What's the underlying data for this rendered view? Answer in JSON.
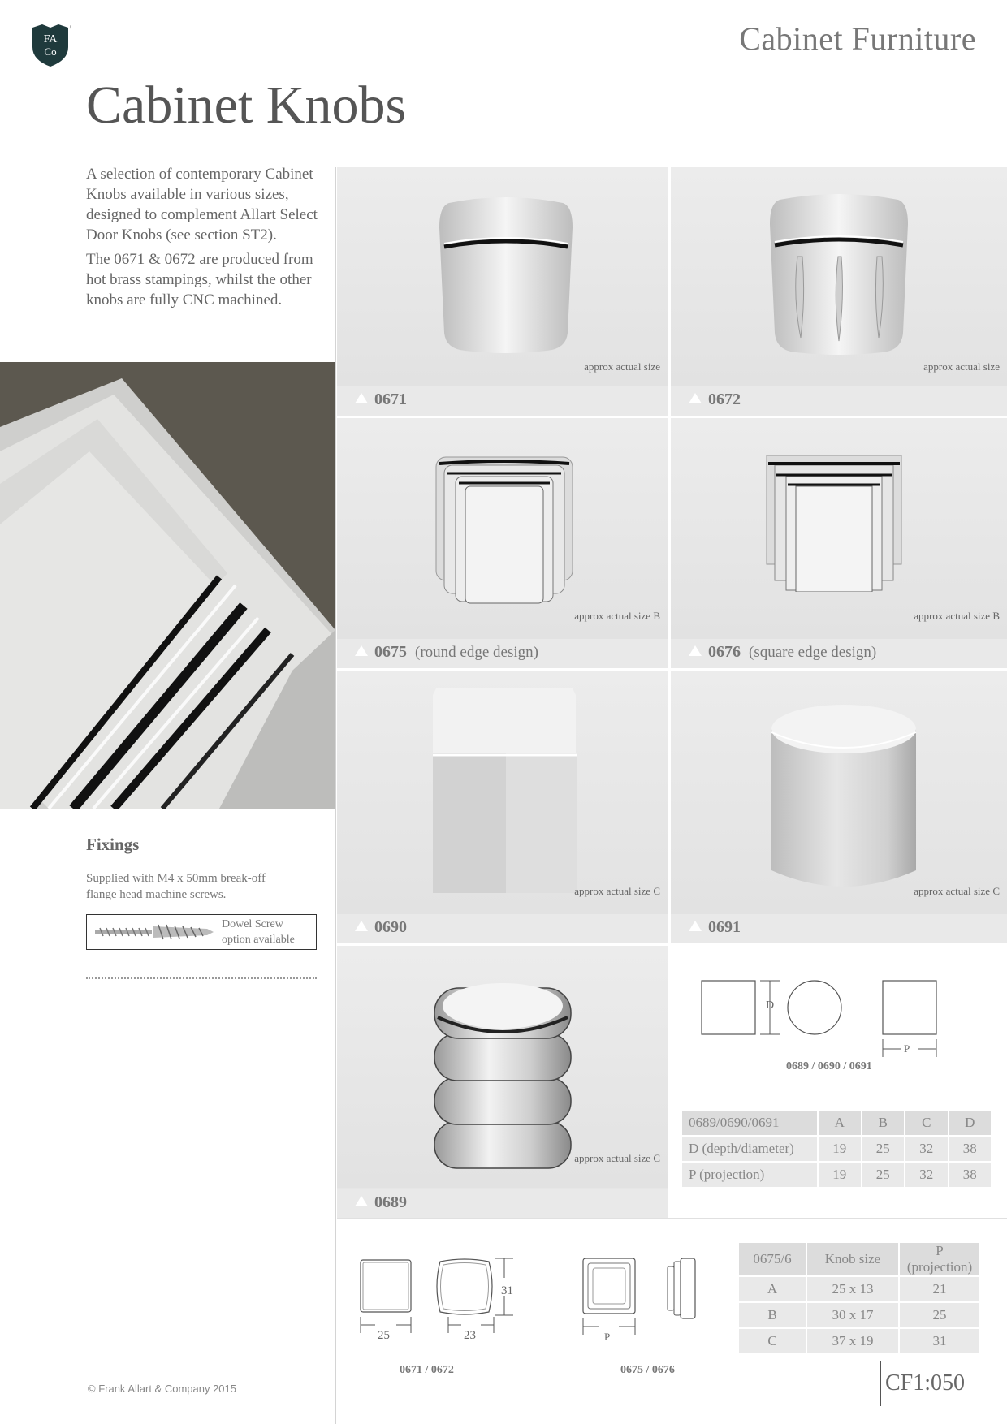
{
  "header": {
    "logo_text": "FA Co",
    "section_title": "Cabinet Furniture",
    "page_title": "Cabinet Knobs"
  },
  "intro": {
    "paragraph1": "A selection of contemporary Cabinet Knobs available in various sizes, designed to complement Allart Select Door Knobs (see section ST2).",
    "paragraph2": "The 0671 & 0672 are produced from hot brass stampings, whilst the other knobs are fully CNC machined."
  },
  "fixings": {
    "title": "Fixings",
    "text": "Supplied with M4 x 50mm break-off flange head machine screws.",
    "dowel_line1": "Dowel Screw",
    "dowel_line2": "option available"
  },
  "products": [
    {
      "code": "0671",
      "desc": "",
      "approx": "approx actual size"
    },
    {
      "code": "0672",
      "desc": "",
      "approx": "approx actual size"
    },
    {
      "code": "0675",
      "desc": "(round edge design)",
      "approx": "approx actual size B"
    },
    {
      "code": "0676",
      "desc": "(square edge design)",
      "approx": "approx actual size B"
    },
    {
      "code": "0690",
      "desc": "",
      "approx": "approx actual size C"
    },
    {
      "code": "0691",
      "desc": "",
      "approx": "approx actual size C"
    },
    {
      "code": "0689",
      "desc": "",
      "approx": "approx actual size C"
    }
  ],
  "diagram_top": {
    "label": "0689 / 0690 / 0691",
    "d": "D",
    "p": "P"
  },
  "table1": {
    "header": [
      "0689/0690/0691",
      "A",
      "B",
      "C",
      "D"
    ],
    "rows": [
      [
        "D (depth/diameter)",
        "19",
        "25",
        "32",
        "38"
      ],
      [
        "P (projection)",
        "19",
        "25",
        "32",
        "38"
      ]
    ]
  },
  "diagram_bottom": {
    "dim_25": "25",
    "dim_23": "23",
    "dim_31": "31",
    "p": "P",
    "label_left": "0671 / 0672",
    "label_right": "0675 / 0676"
  },
  "table2": {
    "header": [
      "0675/6",
      "Knob size",
      "P (projection)"
    ],
    "rows": [
      [
        "A",
        "25 x 13",
        "21"
      ],
      [
        "B",
        "30 x 17",
        "25"
      ],
      [
        "C",
        "37 x 19",
        "31"
      ]
    ]
  },
  "footer": {
    "copyright": "© Frank Allart & Company 2015",
    "page_number": "CF1:050"
  }
}
